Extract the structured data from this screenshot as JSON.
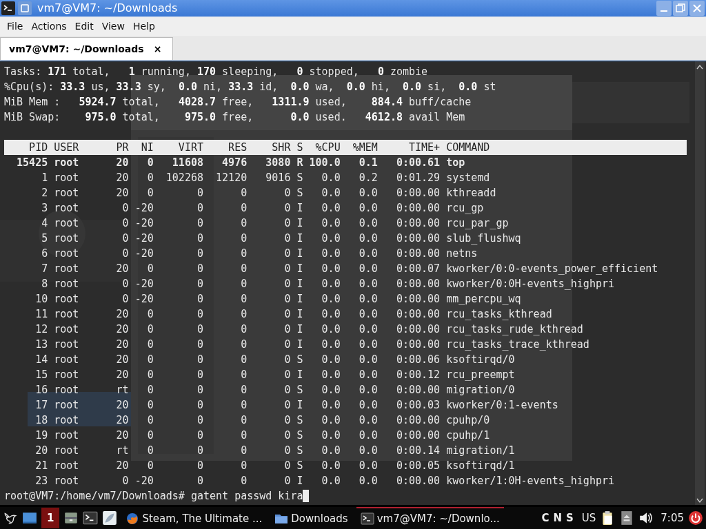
{
  "window": {
    "title": "vm7@VM7: ~/Downloads"
  },
  "menu": [
    "File",
    "Actions",
    "Edit",
    "View",
    "Help"
  ],
  "tabs": [
    {
      "label": "vm7@VM7: ~/Downloads",
      "selected": true,
      "close": "×"
    }
  ],
  "terminal": {
    "summary": [
      "Tasks: **171** total,   **1** running, **170** sleeping,   **0** stopped,   **0** zombie",
      "%Cpu(s): **33.3** us, **33.3** sy,  **0.0** ni, **33.3** id,  **0.0** wa,  **0.0** hi,  **0.0** si,  **0.0** st",
      "MiB Mem :   **5924.7** total,   **4028.7** free,   **1311.9** used,    **884.4** buff/cache",
      "MiB Swap:    **975.0** total,    **975.0** free,      **0.0** used.   **4612.8** avail Mem"
    ],
    "columns": [
      "PID",
      "USER",
      "PR",
      "NI",
      "VIRT",
      "RES",
      "SHR",
      "S",
      "%CPU",
      "%MEM",
      "TIME+",
      "COMMAND"
    ],
    "rows": [
      {
        "bold": true,
        "cells": [
          "15425",
          "root",
          "20",
          "0",
          "11608",
          "4976",
          "3080",
          "R",
          "100.0",
          "0.1",
          "0:00.61",
          "top"
        ]
      },
      {
        "bold": false,
        "cells": [
          "1",
          "root",
          "20",
          "0",
          "102268",
          "12120",
          "9016",
          "S",
          "0.0",
          "0.2",
          "0:01.29",
          "systemd"
        ]
      },
      {
        "bold": false,
        "cells": [
          "2",
          "root",
          "20",
          "0",
          "0",
          "0",
          "0",
          "S",
          "0.0",
          "0.0",
          "0:00.00",
          "kthreadd"
        ]
      },
      {
        "bold": false,
        "cells": [
          "3",
          "root",
          "0",
          "-20",
          "0",
          "0",
          "0",
          "I",
          "0.0",
          "0.0",
          "0:00.00",
          "rcu_gp"
        ]
      },
      {
        "bold": false,
        "cells": [
          "4",
          "root",
          "0",
          "-20",
          "0",
          "0",
          "0",
          "I",
          "0.0",
          "0.0",
          "0:00.00",
          "rcu_par_gp"
        ]
      },
      {
        "bold": false,
        "cells": [
          "5",
          "root",
          "0",
          "-20",
          "0",
          "0",
          "0",
          "I",
          "0.0",
          "0.0",
          "0:00.00",
          "slub_flushwq"
        ]
      },
      {
        "bold": false,
        "cells": [
          "6",
          "root",
          "0",
          "-20",
          "0",
          "0",
          "0",
          "I",
          "0.0",
          "0.0",
          "0:00.00",
          "netns"
        ]
      },
      {
        "bold": false,
        "cells": [
          "7",
          "root",
          "20",
          "0",
          "0",
          "0",
          "0",
          "I",
          "0.0",
          "0.0",
          "0:00.07",
          "kworker/0:0-events_power_efficient"
        ]
      },
      {
        "bold": false,
        "cells": [
          "8",
          "root",
          "0",
          "-20",
          "0",
          "0",
          "0",
          "I",
          "0.0",
          "0.0",
          "0:00.00",
          "kworker/0:0H-events_highpri"
        ]
      },
      {
        "bold": false,
        "cells": [
          "10",
          "root",
          "0",
          "-20",
          "0",
          "0",
          "0",
          "I",
          "0.0",
          "0.0",
          "0:00.00",
          "mm_percpu_wq"
        ]
      },
      {
        "bold": false,
        "cells": [
          "11",
          "root",
          "20",
          "0",
          "0",
          "0",
          "0",
          "I",
          "0.0",
          "0.0",
          "0:00.00",
          "rcu_tasks_kthread"
        ]
      },
      {
        "bold": false,
        "cells": [
          "12",
          "root",
          "20",
          "0",
          "0",
          "0",
          "0",
          "I",
          "0.0",
          "0.0",
          "0:00.00",
          "rcu_tasks_rude_kthread"
        ]
      },
      {
        "bold": false,
        "cells": [
          "13",
          "root",
          "20",
          "0",
          "0",
          "0",
          "0",
          "I",
          "0.0",
          "0.0",
          "0:00.00",
          "rcu_tasks_trace_kthread"
        ]
      },
      {
        "bold": false,
        "cells": [
          "14",
          "root",
          "20",
          "0",
          "0",
          "0",
          "0",
          "S",
          "0.0",
          "0.0",
          "0:00.06",
          "ksoftirqd/0"
        ]
      },
      {
        "bold": false,
        "cells": [
          "15",
          "root",
          "20",
          "0",
          "0",
          "0",
          "0",
          "I",
          "0.0",
          "0.0",
          "0:00.12",
          "rcu_preempt"
        ]
      },
      {
        "bold": false,
        "cells": [
          "16",
          "root",
          "rt",
          "0",
          "0",
          "0",
          "0",
          "S",
          "0.0",
          "0.0",
          "0:00.00",
          "migration/0"
        ]
      },
      {
        "bold": false,
        "cells": [
          "17",
          "root",
          "20",
          "0",
          "0",
          "0",
          "0",
          "I",
          "0.0",
          "0.0",
          "0:00.03",
          "kworker/0:1-events"
        ]
      },
      {
        "bold": false,
        "cells": [
          "18",
          "root",
          "20",
          "0",
          "0",
          "0",
          "0",
          "S",
          "0.0",
          "0.0",
          "0:00.00",
          "cpuhp/0"
        ]
      },
      {
        "bold": false,
        "cells": [
          "19",
          "root",
          "20",
          "0",
          "0",
          "0",
          "0",
          "S",
          "0.0",
          "0.0",
          "0:00.00",
          "cpuhp/1"
        ]
      },
      {
        "bold": false,
        "cells": [
          "20",
          "root",
          "rt",
          "0",
          "0",
          "0",
          "0",
          "S",
          "0.0",
          "0.0",
          "0:00.14",
          "migration/1"
        ]
      },
      {
        "bold": false,
        "cells": [
          "21",
          "root",
          "20",
          "0",
          "0",
          "0",
          "0",
          "S",
          "0.0",
          "0.0",
          "0:00.05",
          "ksoftirqd/1"
        ]
      },
      {
        "bold": false,
        "cells": [
          "23",
          "root",
          "0",
          "-20",
          "0",
          "0",
          "0",
          "I",
          "0.0",
          "0.0",
          "0:00.00",
          "kworker/1:0H-events_highpri"
        ]
      }
    ],
    "prompt": "root@VM7:/home/vm7/Downloads# gatent passwd kira"
  },
  "taskbar": {
    "workspace": "1",
    "tasks": [
      {
        "kind": "browser",
        "label": "Steam, The Ultimate ...",
        "selected": false
      },
      {
        "kind": "folder",
        "label": "Downloads",
        "selected": false
      },
      {
        "kind": "terminal",
        "label": "vm7@VM7: ~/Downlo...",
        "selected": true
      }
    ],
    "indicators": [
      "C",
      "N",
      "S"
    ],
    "layout": "US",
    "clock": "7:05"
  }
}
